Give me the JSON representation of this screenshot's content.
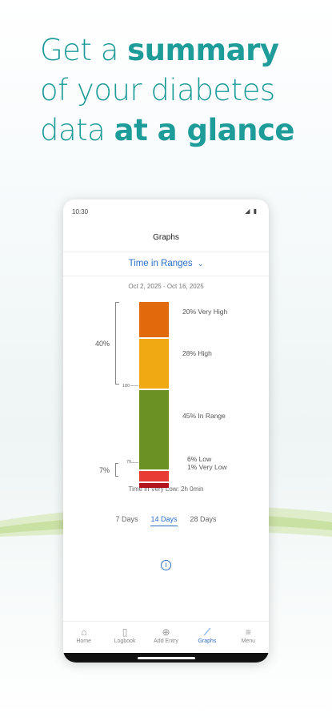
{
  "headline": {
    "line1_plain": "Get a ",
    "line1_bold": "summary",
    "line2": "of your diabetes",
    "line3_plain": "data ",
    "line3_bold": "at a glance"
  },
  "status": {
    "time": "10:30",
    "indicators": "◢ ▮"
  },
  "appbar": {
    "title": "Graphs"
  },
  "dropdown": {
    "label": "Time in Ranges",
    "icon": "chevron-down-icon"
  },
  "date_range": "Oct 2, 2025 - Oct 16, 2025",
  "chart_data": {
    "type": "bar",
    "title": "Time in Ranges",
    "segments": [
      {
        "name": "Very High",
        "value": 20,
        "label": "20% Very High",
        "color": "#e06a0c"
      },
      {
        "name": "High",
        "value": 28,
        "label": "28% High",
        "color": "#f0a912"
      },
      {
        "name": "In Range",
        "value": 45,
        "label": "45% In Range",
        "color": "#6b9124"
      },
      {
        "name": "Low",
        "value": 6,
        "label": "6% Low",
        "color": "#e73b34"
      },
      {
        "name": "Very Low",
        "value": 1,
        "label": "1% Very Low",
        "color": "#b3131d"
      }
    ],
    "thresholds": [
      "180",
      "70"
    ],
    "group_totals": {
      "above": "40%",
      "below": "7%"
    }
  },
  "time_very_low": "Time in Very Low: 2h 0min",
  "tabs": [
    "7 Days",
    "14 Days",
    "28 Days"
  ],
  "active_tab": "14 Days",
  "nav": [
    {
      "label": "Home",
      "icon": "home-icon",
      "glyph": "⌂"
    },
    {
      "label": "Logbook",
      "icon": "logbook-icon",
      "glyph": "▯"
    },
    {
      "label": "Add Entry",
      "icon": "add-entry-icon",
      "glyph": "⊕"
    },
    {
      "label": "Graphs",
      "icon": "graphs-icon",
      "glyph": "⟋"
    },
    {
      "label": "Menu",
      "icon": "menu-icon",
      "glyph": "≡"
    }
  ]
}
